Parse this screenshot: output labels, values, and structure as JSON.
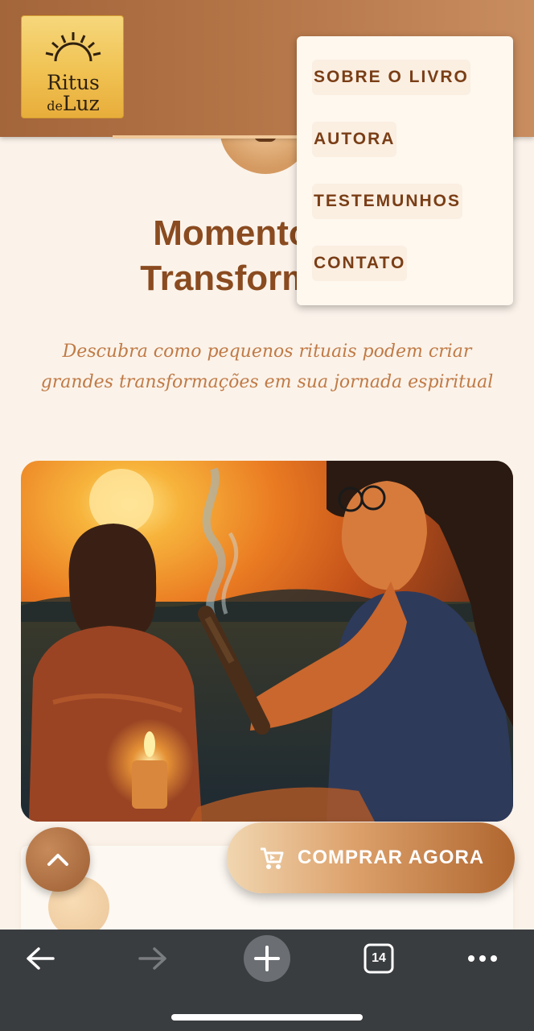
{
  "logo": {
    "line1": "Ritus",
    "line2_prefix": "de",
    "line2_main": "Luz"
  },
  "menu": {
    "items": [
      {
        "label": "SOBRE O LIVRO"
      },
      {
        "label": "AUTORA"
      },
      {
        "label": "TESTEMUNHOS"
      },
      {
        "label": "CONTATO"
      }
    ]
  },
  "hero": {
    "title_line1": "Momentos de",
    "title_line2": "Transformação",
    "subtitle_line1": "Descubra como pequenos rituais podem criar",
    "subtitle_line2": "grandes transformações em sua jornada espiritual"
  },
  "actions": {
    "buy_label": "COMPRAR AGORA"
  },
  "browser": {
    "tab_count": "14"
  },
  "colors": {
    "brand_brown": "#8a4b20",
    "accent_gold": "#f0c252",
    "header_bg": "#a3653a",
    "page_bg": "#fbf3ea"
  },
  "icons": [
    "sun-icon",
    "chevron-up-icon",
    "cart-icon",
    "back-arrow-icon",
    "forward-arrow-icon",
    "plus-icon",
    "tabs-icon",
    "more-icon"
  ]
}
